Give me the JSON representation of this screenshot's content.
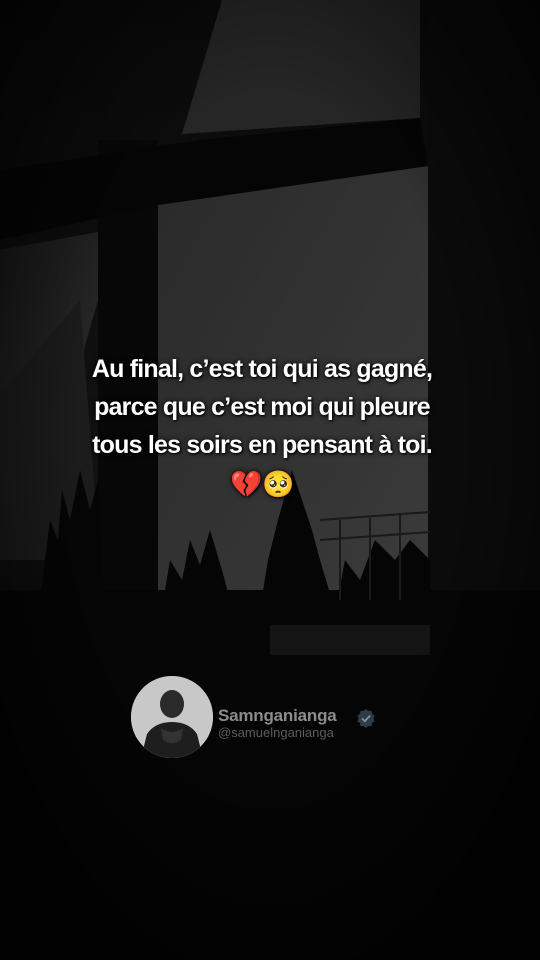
{
  "quote": {
    "line1": "Au final, c’est toi qui as gagné,",
    "line2": "parce que c’est moi qui pleure",
    "line3": "tous les soirs en pensant à toi.",
    "emojis": "💔🥺"
  },
  "credit": {
    "display_name": "Samnganianga",
    "username": "@samuelnganianga",
    "avatar_icon": "person-portrait-icon",
    "badge_icon": "verified-badge-icon"
  },
  "colors": {
    "background": "#000000",
    "text": "#ffffff",
    "credit_text": "#8c8c8c",
    "credit_subtext": "#5c5c5c"
  }
}
